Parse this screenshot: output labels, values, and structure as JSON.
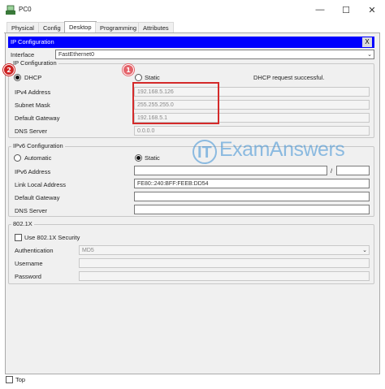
{
  "window": {
    "title": "PC0"
  },
  "tabs": [
    {
      "label": "Physical"
    },
    {
      "label": "Config"
    },
    {
      "label": "Desktop"
    },
    {
      "label": "Programming"
    },
    {
      "label": "Attributes"
    }
  ],
  "active_tab": "Desktop",
  "ip_configuration": {
    "header": "IP Configuration",
    "close_label": "X",
    "interface_label": "Interface",
    "interface_value": "FastEthernet0"
  },
  "ipv4": {
    "group_title": "IP Configuration",
    "dhcp_label": "DHCP",
    "static_label": "Static",
    "mode": "DHCP",
    "status": "DHCP request successful.",
    "ipv4_address_label": "IPv4 Address",
    "ipv4_address": "192.168.5.126",
    "subnet_mask_label": "Subnet Mask",
    "subnet_mask": "255.255.255.0",
    "default_gateway_label": "Default Gateway",
    "default_gateway": "192.168.5.1",
    "dns_server_label": "DNS Server",
    "dns_server": "0.0.0.0"
  },
  "ipv6": {
    "group_title": "IPv6 Configuration",
    "automatic_label": "Automatic",
    "static_label": "Static",
    "mode": "Static",
    "ipv6_address_label": "IPv6 Address",
    "ipv6_address": "",
    "prefix_separator": "/",
    "prefix": "",
    "link_local_label": "Link Local Address",
    "link_local_value": "FE80::240:BFF:FEEB:DD54",
    "default_gateway_label": "Default Gateway",
    "default_gateway": "",
    "dns_server_label": "DNS Server",
    "dns_server": ""
  },
  "dot1x": {
    "group_title": "802.1X",
    "use_security_label": "Use 802.1X Security",
    "authentication_label": "Authentication",
    "authentication_value": "MD5",
    "username_label": "Username",
    "password_label": "Password"
  },
  "footer": {
    "top_label": "Top"
  },
  "annotations": {
    "badge_1": "1",
    "badge_2": "2"
  },
  "watermark": {
    "logo_text": "IT",
    "text": "ExamAnswers"
  },
  "colors": {
    "header_blue": "#0000ff",
    "annotation_red": "#d42a2a",
    "watermark_blue": "#3a8fd4"
  },
  "icons": {
    "app": "packet-tracer-pc-icon",
    "minimize": "minimize-icon",
    "maximize": "maximize-icon",
    "close": "close-icon"
  }
}
